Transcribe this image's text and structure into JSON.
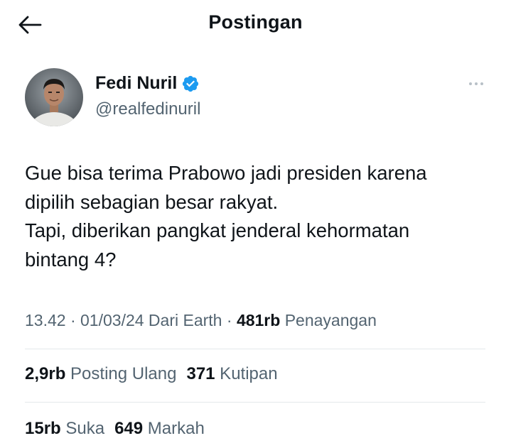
{
  "header": {
    "title": "Postingan",
    "back_icon": "arrow-left-icon"
  },
  "author": {
    "name": "Fedi Nuril",
    "handle": "@realfedinuril",
    "verified_icon": "verified-badge-icon",
    "verified_color": "#1d9bf0",
    "avatar_icon": "profile-photo"
  },
  "more_icon": "more-horizontal-icon",
  "tweet": {
    "lines": [
      "Gue bisa terima Prabowo jadi presiden karena",
      "dipilih sebagian besar rakyat.",
      "Tapi, diberikan pangkat jenderal kehormatan",
      "bintang 4?"
    ]
  },
  "meta": {
    "time": "13.42",
    "sep1": " · ",
    "date": "01/03/24",
    "source": " Dari Earth",
    "sep2": " · ",
    "views_count": "481rb",
    "views_label": " Penayangan"
  },
  "stats": {
    "reposts_count": "2,9rb",
    "reposts_label": " Posting Ulang",
    "quotes_count": "371",
    "quotes_label": " Kutipan",
    "likes_count": "15rb",
    "likes_label": " Suka",
    "bookmarks_count": "649",
    "bookmarks_label": " Markah"
  }
}
